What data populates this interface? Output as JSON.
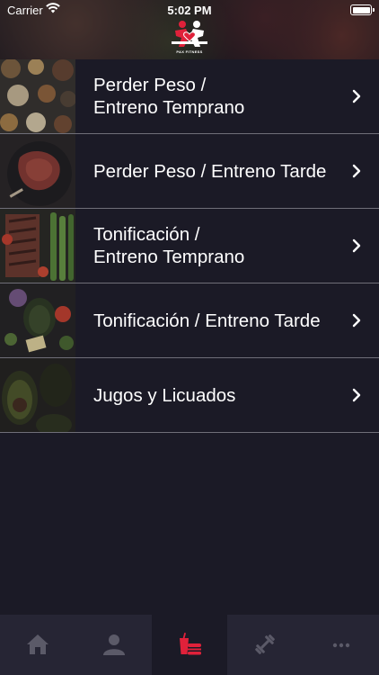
{
  "status_bar": {
    "carrier": "Carrier",
    "time": "5:02 PM"
  },
  "header": {
    "logo_text": "PAX FITNESS"
  },
  "menu": {
    "items": [
      {
        "label": "Perder Peso /\nEntreno Temprano",
        "thumb": "food-thumbnail-nuts-grains"
      },
      {
        "label": "Perder Peso / Entreno Tarde",
        "thumb": "food-thumbnail-steak"
      },
      {
        "label": "Tonificación /\nEntreno Temprano",
        "thumb": "food-thumbnail-grilled-vegetables"
      },
      {
        "label": "Tonificación / Entreno Tarde",
        "thumb": "food-thumbnail-avocado-salad"
      },
      {
        "label": "Jugos y Licuados",
        "thumb": "food-thumbnail-avocado"
      }
    ]
  },
  "tabbar": {
    "tabs": [
      {
        "icon": "home-icon",
        "active": false
      },
      {
        "icon": "profile-icon",
        "active": false
      },
      {
        "icon": "food-drink-icon",
        "active": true
      },
      {
        "icon": "dumbbell-icon",
        "active": false
      },
      {
        "icon": "more-icon",
        "active": false
      }
    ]
  },
  "colors": {
    "background": "#1b1a26",
    "tabbar": "#262534",
    "accent": "#e0213a",
    "inactive_icon": "#5b5a68",
    "divider": "#6f6e78"
  }
}
